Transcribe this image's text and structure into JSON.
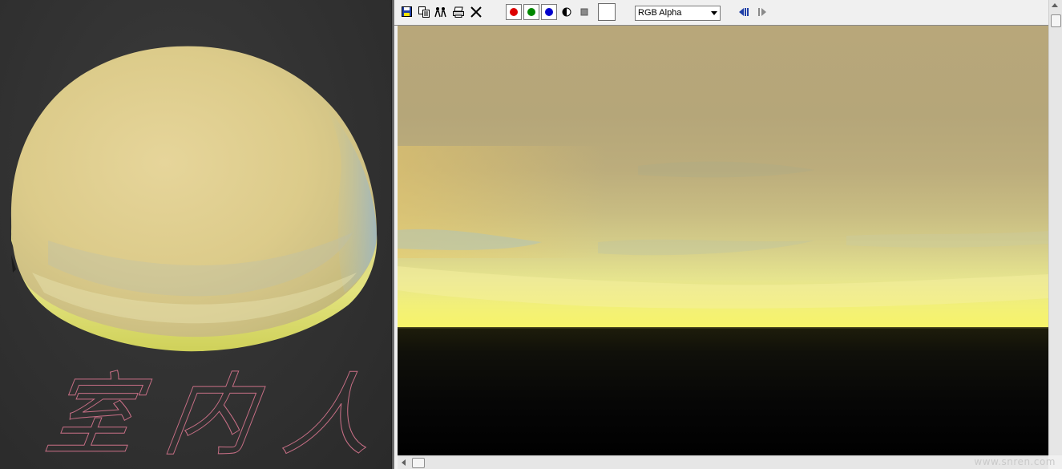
{
  "viewport": {
    "watermark_glyphs": [
      "室",
      "内",
      "人"
    ]
  },
  "frame_buffer": {
    "toolbar": {
      "icons": [
        "save-icon",
        "copy-icon",
        "clone-icon",
        "print-icon",
        "clear-icon"
      ],
      "channels": [
        {
          "name": "red-channel",
          "color": "#dd0000"
        },
        {
          "name": "green-channel",
          "color": "#008800"
        },
        {
          "name": "blue-channel",
          "color": "#0000cc"
        }
      ],
      "mono_icon": "monochrome-icon",
      "alpha_icon": "alpha-icon",
      "swatch_color": "#ffffff",
      "channel_select": {
        "value": "RGB Alpha"
      },
      "nav_icons": [
        "previous-frame-icon",
        "next-frame-icon"
      ]
    },
    "render": {
      "sky_color_top": "#b8a77a",
      "horizon_color": "#f7f46a",
      "ground_color": "#000000"
    }
  },
  "site_watermark": "www.snren.com"
}
